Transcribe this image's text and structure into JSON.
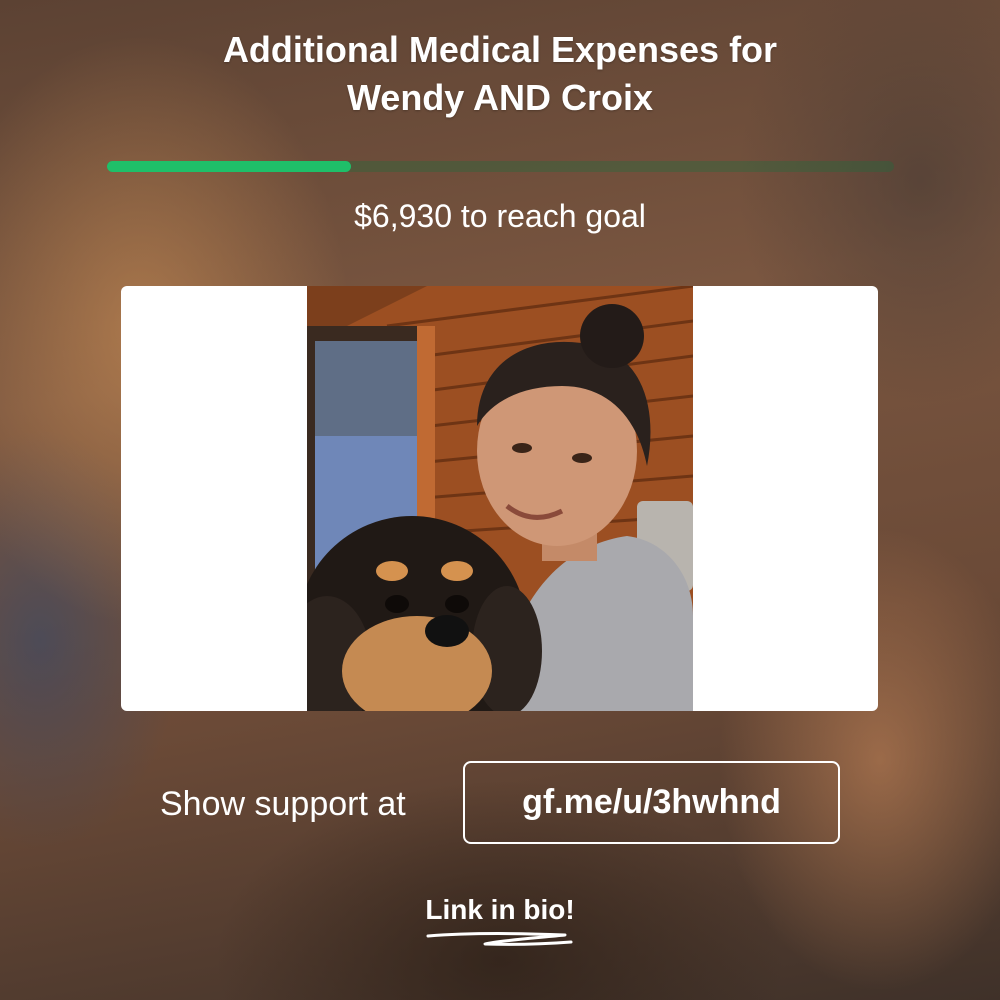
{
  "campaign": {
    "title_line1": "Additional Medical Expenses for",
    "title_line2": "Wendy AND Croix",
    "progress_fraction": 0.31,
    "goal_text": "$6,930 to reach goal"
  },
  "support": {
    "label": "Show support at",
    "link": "gf.me/u/3hwhnd"
  },
  "footer": {
    "bio_text": "Link in bio!"
  },
  "colors": {
    "progress_fill": "#1fbf69",
    "text": "#ffffff"
  }
}
